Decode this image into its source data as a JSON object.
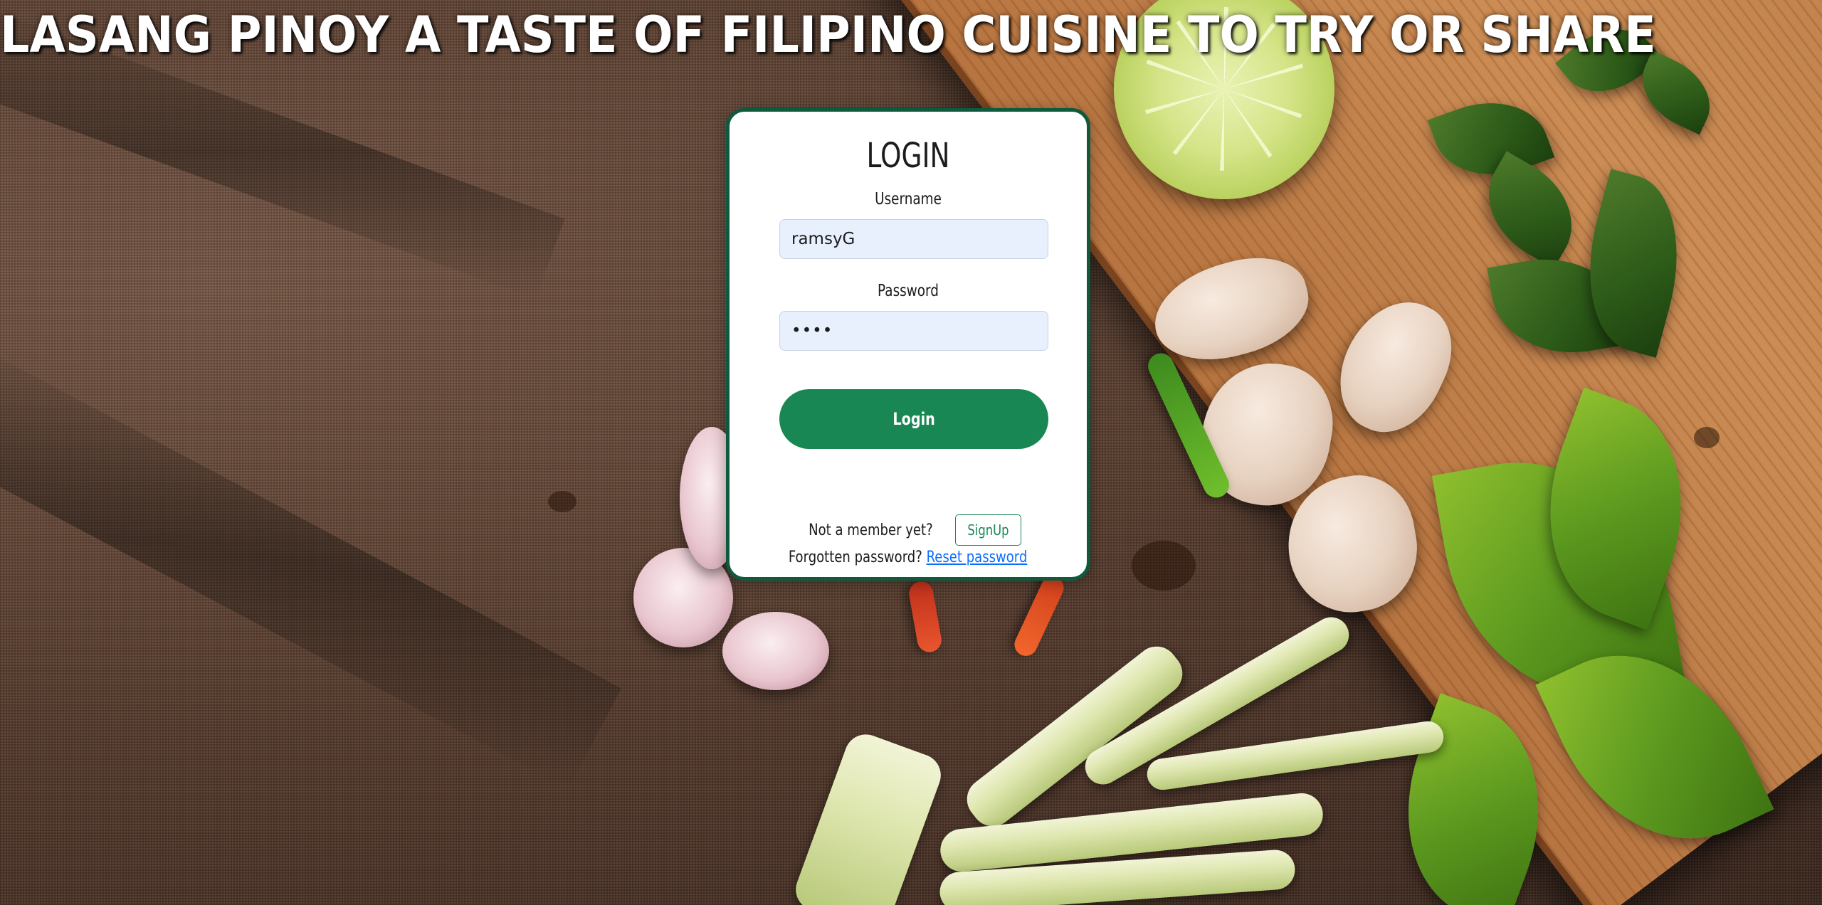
{
  "header": {
    "title": "LASANG PINOY A TASTE OF FILIPINO CUISINE TO TRY OR SHARE"
  },
  "login": {
    "title": "LOGIN",
    "username_label": "Username",
    "username_value": "ramsyG",
    "password_label": "Password",
    "password_value": "••••",
    "submit_label": "Login",
    "member_prompt": "Not a member yet?",
    "signup_label": "SignUp",
    "forgot_prompt": "Forgotten password?",
    "reset_link_label": "Reset password"
  },
  "colors": {
    "card_border": "#0f5a3c",
    "primary_button": "#198754",
    "input_background": "#e8f0fe",
    "link": "#0d6efd"
  }
}
